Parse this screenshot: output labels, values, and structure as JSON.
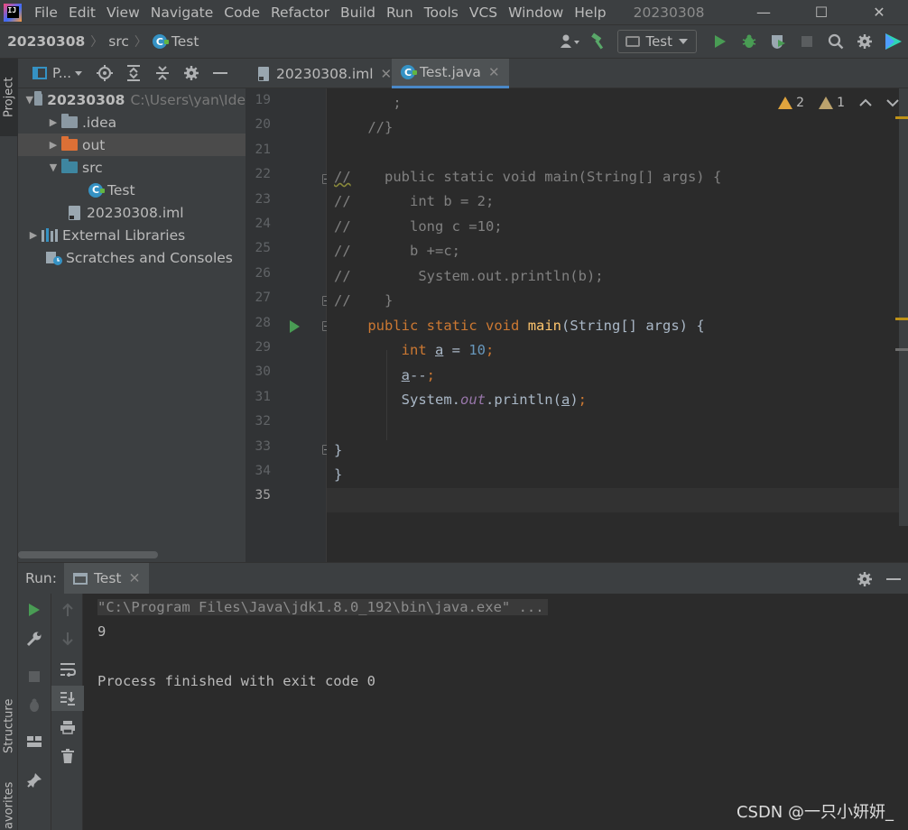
{
  "menubar": {
    "logo_letters": "IJ",
    "items": [
      "File",
      "Edit",
      "View",
      "Navigate",
      "Code",
      "Refactor",
      "Build",
      "Run",
      "Tools",
      "VCS",
      "Window",
      "Help"
    ],
    "title": "20230308",
    "minimize": "—",
    "maximize": "☐",
    "close": "✕"
  },
  "navbar": {
    "project": "20230308",
    "folder": "src",
    "file": "Test",
    "run_config": "Test"
  },
  "left_stripe": {
    "project": "Project",
    "structure": "Structure",
    "favorites": "avorites"
  },
  "project_toolbar": {
    "view_label": "P..."
  },
  "tree": [
    {
      "label": "20230308",
      "hint": "C:\\Users\\yan\\Ide"
    },
    {
      "label": ".idea"
    },
    {
      "label": "out"
    },
    {
      "label": "src"
    },
    {
      "label": "Test"
    },
    {
      "label": "20230308.iml"
    },
    {
      "label": "External Libraries"
    },
    {
      "label": "Scratches and Consoles"
    }
  ],
  "editor_tabs": [
    {
      "label": "20230308.iml"
    },
    {
      "label": "Test.java"
    }
  ],
  "inspections": {
    "warnings": "2",
    "weak_warnings": "1"
  },
  "line_numbers": [
    "19",
    "20",
    "21",
    "22",
    "23",
    "24",
    "25",
    "26",
    "27",
    "28",
    "29",
    "30",
    "31",
    "32",
    "33",
    "34",
    "35"
  ],
  "code": {
    "l19": "       ;",
    "l20": "    //}",
    "l22a": "//",
    "l22b": "    public static void main(String[] args) {",
    "l23": "//       int b = 2;",
    "l24": "//       long c =10;",
    "l25": "//       b +=c;",
    "l26": "//        System.out.println(b);",
    "l27": "//    }",
    "public": "public",
    "static": "static",
    "void": "void",
    "main": "main",
    "main_params": "(String[] args) {",
    "int": "int",
    "a": "a",
    "assign": " = ",
    "ten": "10",
    "semi": ";",
    "dec": "--",
    "sys": "System.",
    "out": "out",
    "println": ".println(",
    "close_paren": ")",
    "brace": "}",
    "class_brace": "}"
  },
  "run_panel": {
    "label": "Run:",
    "tab": "Test",
    "console": [
      "\"C:\\Program Files\\Java\\jdk1.8.0_192\\bin\\java.exe\" ...",
      "9",
      "",
      "Process finished with exit code 0"
    ]
  },
  "watermark": "CSDN @一只小妍妍_"
}
